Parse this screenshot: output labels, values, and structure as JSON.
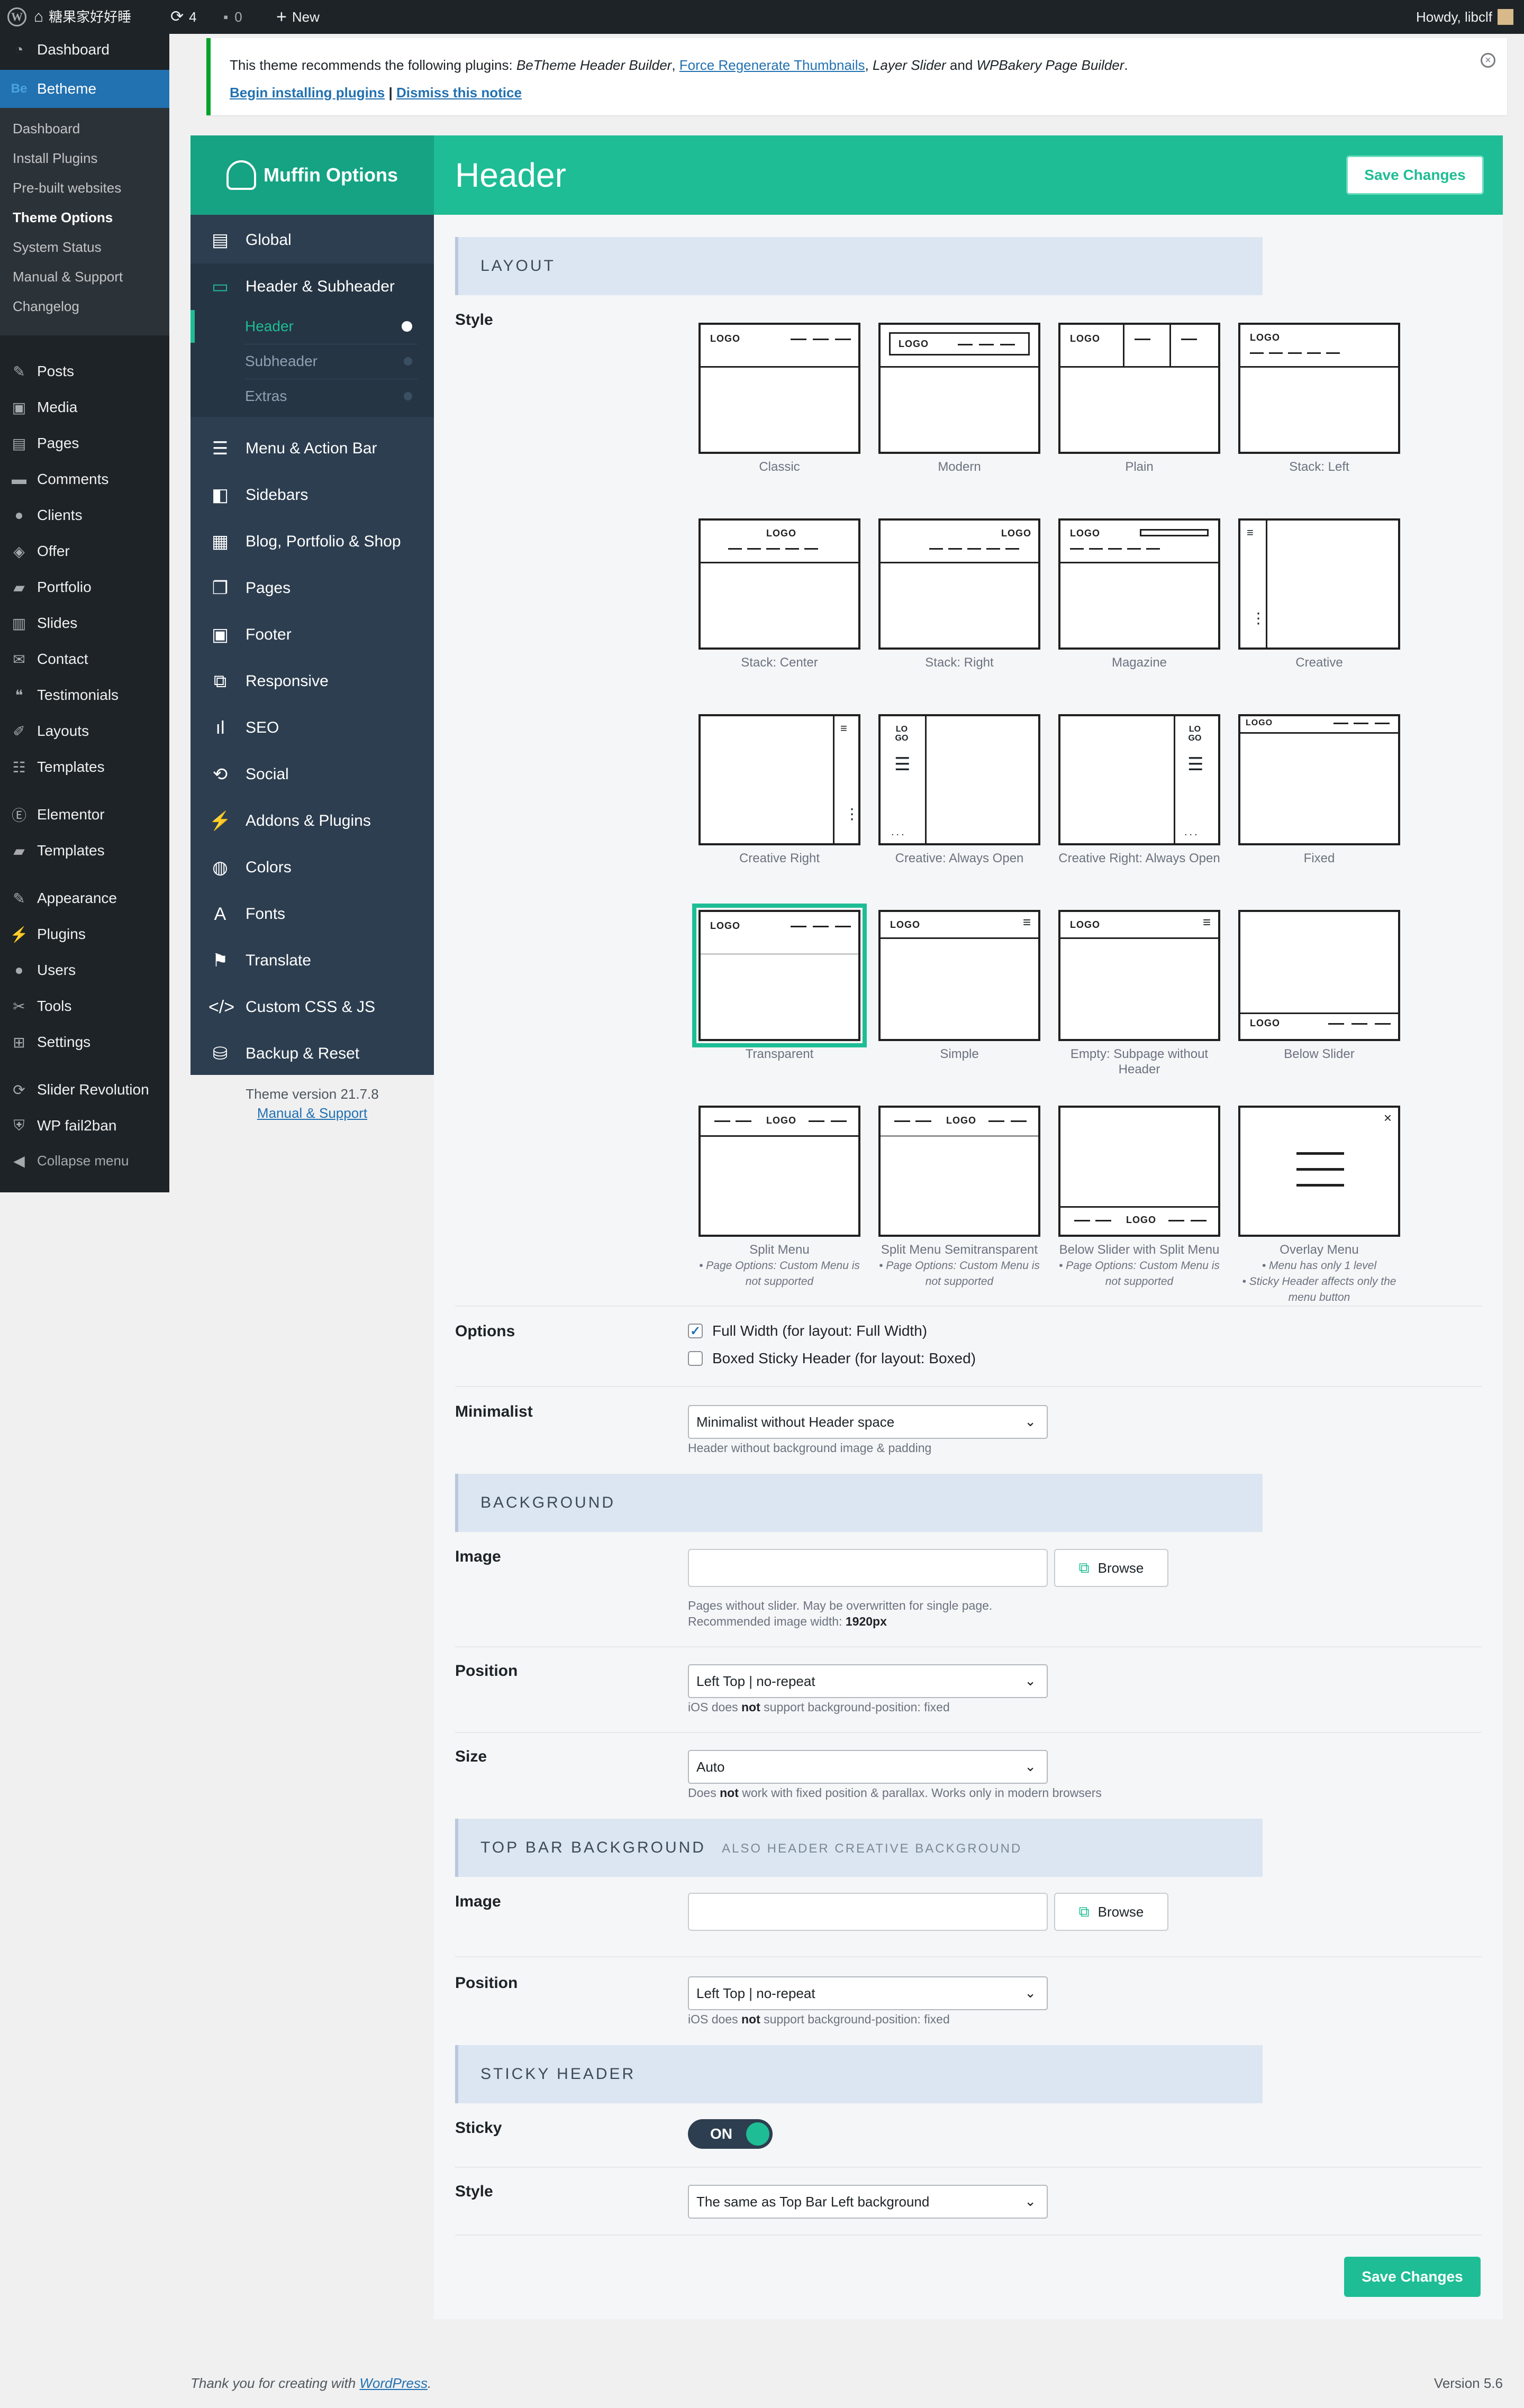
{
  "adminbar": {
    "site_name": "糖果家好好睡",
    "updates": "4",
    "comments": "0",
    "new_label": "New",
    "howdy": "Howdy, libclf"
  },
  "menu": {
    "dashboard": "Dashboard",
    "betheme": "Betheme",
    "betheme_sub": [
      "Dashboard",
      "Install Plugins",
      "Pre-built websites",
      "Theme Options",
      "System Status",
      "Manual & Support",
      "Changelog"
    ],
    "items": [
      "Posts",
      "Media",
      "Pages",
      "Comments",
      "Clients",
      "Offer",
      "Portfolio",
      "Slides",
      "Contact",
      "Testimonials",
      "Layouts",
      "Templates"
    ],
    "items2": [
      "Elementor",
      "Templates"
    ],
    "items3": [
      "Appearance",
      "Plugins",
      "Users",
      "Tools",
      "Settings"
    ],
    "items4": [
      "Slider Revolution",
      "WP fail2ban",
      "Collapse menu"
    ]
  },
  "notice": {
    "prefix": "This theme recommends the following plugins: ",
    "p1": "BeTheme Header Builder",
    "sep1": ", ",
    "p2": "Force Regenerate Thumbnails",
    "sep2": ", ",
    "p3": "Layer Slider",
    "and": " and ",
    "p4": "WPBakery Page Builder",
    "end": ".",
    "begin": "Begin installing plugins",
    "pipe": " | ",
    "dismiss": "Dismiss this notice"
  },
  "muffin": {
    "logo_text": "Muffin Options",
    "page_title": "Header",
    "save": "Save Changes",
    "nav": [
      "Global",
      "Header & Subheader",
      "Menu & Action Bar",
      "Sidebars",
      "Blog, Portfolio & Shop",
      "Pages",
      "Footer",
      "Responsive",
      "SEO",
      "Social",
      "Addons & Plugins",
      "Colors",
      "Fonts",
      "Translate",
      "Custom CSS & JS",
      "Backup & Reset"
    ],
    "nav_sub": [
      "Header",
      "Subheader",
      "Extras"
    ],
    "version": "Theme version 21.7.8",
    "manual": "Manual & Support"
  },
  "layout": {
    "section": "LAYOUT",
    "style_label": "Style",
    "logo_word": "LOGO",
    "tiles": [
      {
        "label": "Classic"
      },
      {
        "label": "Modern"
      },
      {
        "label": "Plain"
      },
      {
        "label": "Stack: Left"
      },
      {
        "label": "Stack: Center"
      },
      {
        "label": "Stack: Right"
      },
      {
        "label": "Magazine"
      },
      {
        "label": "Creative"
      },
      {
        "label": "Creative Right"
      },
      {
        "label": "Creative: Always Open"
      },
      {
        "label": "Creative Right: Always Open"
      },
      {
        "label": "Fixed"
      },
      {
        "label": "Transparent"
      },
      {
        "label": "Simple"
      },
      {
        "label": "Empty: Subpage without Header"
      },
      {
        "label": "Below Slider"
      },
      {
        "label": "Split Menu",
        "note": "• Page Options: Custom Menu is not supported"
      },
      {
        "label": "Split Menu Semitransparent",
        "note": "• Page Options: Custom Menu is not supported"
      },
      {
        "label": "Below Slider with Split Menu",
        "note": "• Page Options: Custom Menu is not supported"
      },
      {
        "label": "Overlay Menu",
        "note": "• Menu has only 1 level",
        "note2": "• Sticky Header affects only the menu button"
      }
    ],
    "selected": "Transparent",
    "options_label": "Options",
    "opt1": "Full Width (for layout: Full Width)",
    "opt1_checked": true,
    "opt2": "Boxed Sticky Header (for layout: Boxed)",
    "opt2_checked": false,
    "minimalist_label": "Minimalist",
    "minimalist_value": "Minimalist without Header space",
    "minimalist_hint": "Header without background image & padding"
  },
  "background": {
    "section": "BACKGROUND",
    "image_label": "Image",
    "browse": "Browse",
    "image_hint1": "Pages without slider. May be overwritten for single page.",
    "image_hint2a": "Recommended image width: ",
    "image_hint2b": "1920px",
    "position_label": "Position",
    "position_value": "Left Top | no-repeat",
    "position_hint_a": "iOS does ",
    "position_hint_b": "not",
    "position_hint_c": " support background-position: fixed",
    "size_label": "Size",
    "size_value": "Auto",
    "size_hint_a": "Does ",
    "size_hint_b": "not",
    "size_hint_c": " work with fixed position & parallax. Works only in modern browsers"
  },
  "topbar": {
    "section": "TOP BAR BACKGROUND",
    "section_sub": "ALSO HEADER CREATIVE BACKGROUND",
    "image_label": "Image",
    "browse": "Browse",
    "position_label": "Position",
    "position_value": "Left Top | no-repeat",
    "position_hint_a": "iOS does ",
    "position_hint_b": "not",
    "position_hint_c": " support background-position: fixed"
  },
  "sticky": {
    "section": "STICKY HEADER",
    "sticky_label": "Sticky",
    "sticky_value": "ON",
    "style_label": "Style",
    "style_value": "The same as Top Bar Left background"
  },
  "footer": {
    "thanks": "Thank you for creating with ",
    "wp": "WordPress",
    "dot": ".",
    "version": "Version 5.6"
  }
}
